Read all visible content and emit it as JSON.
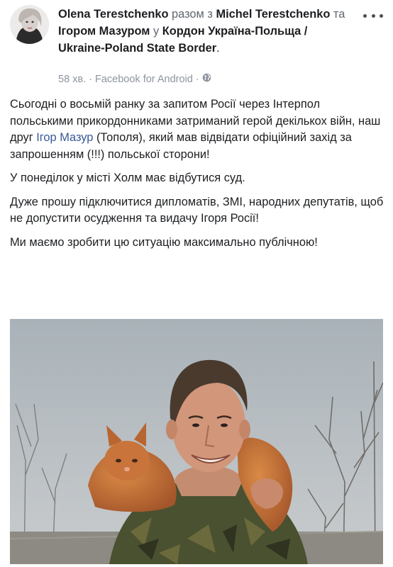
{
  "post": {
    "author": "Olena Terestchenko",
    "with_text": "разом з",
    "tagged_1": "Michel Terestchenko",
    "and_text": "та",
    "tagged_2": "Ігором Мазуром",
    "at_text": "у",
    "location": "Кордон Україна-Польща / Ukraine-Poland State Border",
    "period": ".",
    "time": "58 хв.",
    "sep1": "·",
    "source": "Facebook for Android",
    "sep2": "·",
    "privacy_icon": "globe-icon",
    "more_icon": "more-options-icon"
  },
  "body": {
    "p1_before": "Сьогодні о восьмій ранку за запитом Росії через Інтерпол польськими прикордонниками затриманий герой декількох війн, наш друг ",
    "p1_link": "Ігор Мазур",
    "p1_after": " (Тополя), який мав відвідати офіційний захід за запрошенням (!!!) польської сторони!",
    "p2": "У понеділок у місті Холм має відбутися суд.",
    "p3": "Дуже прошу підключитися дипломатів, ЗМІ, народних депутатів, щоб не допустити осудження та видачу Ігоря Росії!",
    "p4": "Ми маємо зробити цю ситуацію максимально публічною!"
  },
  "colors": {
    "link": "#385898",
    "text": "#1c1e21",
    "meta": "#8d949e"
  }
}
